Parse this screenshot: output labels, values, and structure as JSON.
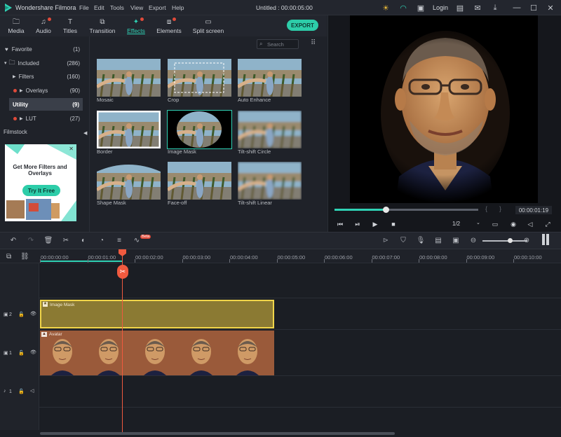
{
  "app": {
    "name": "Wondershare Filmora",
    "window_title": "Untitled : 00:00:05:00",
    "login": "Login"
  },
  "menu": [
    "File",
    "Edit",
    "Tools",
    "View",
    "Export",
    "Help"
  ],
  "tabs": [
    {
      "label": "Media",
      "icon": "folder-icon"
    },
    {
      "label": "Audio",
      "icon": "music-icon"
    },
    {
      "label": "Titles",
      "icon": "text-icon"
    },
    {
      "label": "Transition",
      "icon": "transition-icon"
    },
    {
      "label": "Effects",
      "icon": "effects-icon",
      "active": true
    },
    {
      "label": "Elements",
      "icon": "elements-icon"
    },
    {
      "label": "Split screen",
      "icon": "split-screen-icon"
    }
  ],
  "export_label": "EXPORT",
  "sidebar": {
    "items": [
      {
        "label": "Favorite",
        "count": "(1)"
      },
      {
        "label": "Included",
        "count": "(286)"
      },
      {
        "label": "Filters",
        "count": "(160)"
      },
      {
        "label": "Overlays",
        "count": "(90)"
      },
      {
        "label": "Utility",
        "count": "(9)"
      },
      {
        "label": "LUT",
        "count": "(27)"
      }
    ],
    "filmstock": "Filmstock",
    "promo": {
      "title": "Get More Filters and Overlays",
      "button": "Try It Free"
    }
  },
  "search": {
    "placeholder": "Search"
  },
  "effects": [
    "Mosaic",
    "Crop",
    "Auto Enhance",
    "Border",
    "Image Mask",
    "Tilt-shift Circle",
    "Shape Mask",
    "Face-off",
    "Tilt-shift Linear"
  ],
  "preview": {
    "timecode": "00:00:01:19",
    "quality": "1/2"
  },
  "timeline": {
    "ruler": [
      "00:00:00:00",
      "00:00:01:00",
      "00:00:02:00",
      "00:00:03:00",
      "00:00:04:00",
      "00:00:05:00",
      "00:00:06:00",
      "00:00:07:00",
      "00:00:08:00",
      "00:00:09:00",
      "00:00:10:00"
    ],
    "beta": "Beta",
    "tracks": [
      {
        "num": "2"
      },
      {
        "num": "1"
      },
      {
        "num": "1"
      }
    ],
    "clips": {
      "mask": "Image Mask",
      "avatar": "Avatar"
    }
  },
  "colors": {
    "accent": "#2fd1b4",
    "playhead": "#f05a3f",
    "mask_clip": "#8b7a33",
    "avatar_clip": "#9a5a3a"
  }
}
